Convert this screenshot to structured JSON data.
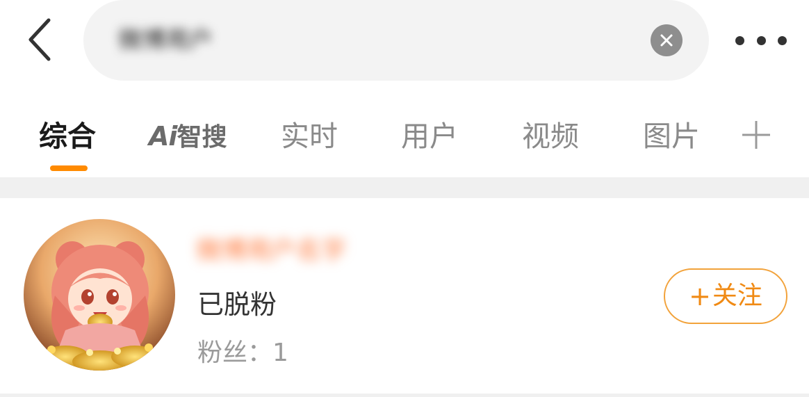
{
  "header": {
    "search_query": "微博用户",
    "icons": {
      "back": "chevron-left-icon",
      "clear": "close-icon",
      "more": "more-dots-icon"
    }
  },
  "tabs": [
    {
      "label": "综合",
      "active": true
    },
    {
      "label_ai": "Ai",
      "label_zh": "智搜"
    },
    {
      "label": "实时"
    },
    {
      "label": "用户"
    },
    {
      "label": "视频"
    },
    {
      "label": "图片"
    }
  ],
  "user": {
    "name": "微博用户名字",
    "status": "已脱粉",
    "fans_label": "粉丝：",
    "fans_count": "1",
    "follow_plus": "+",
    "follow_label": "关注"
  },
  "colors": {
    "accent": "#ff8a00",
    "follow": "#f08a14"
  }
}
